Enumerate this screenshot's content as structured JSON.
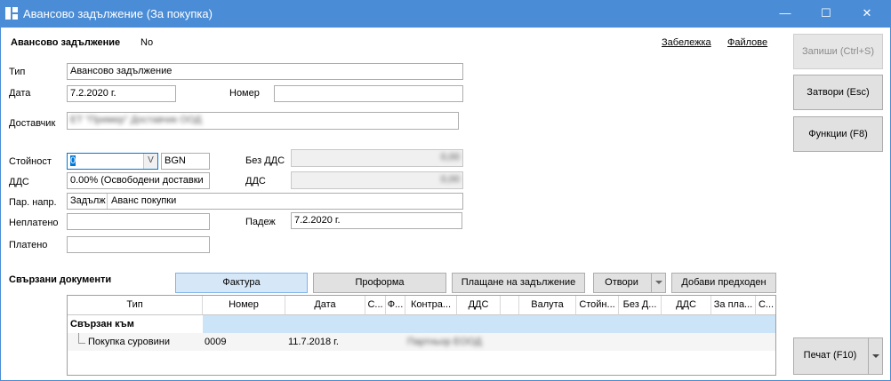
{
  "window": {
    "title": "Авансово задължение (За покупка)",
    "minimize_glyph": "—",
    "maximize_glyph": "☐",
    "close_glyph": "✕"
  },
  "header": {
    "doc_type_label": "Авансово задължение",
    "no_label": "No",
    "note_link": "Забележка",
    "files_link": "Файлове"
  },
  "form": {
    "type_label": "Тип",
    "type_value": "Авансово задължение",
    "date_label": "Дата",
    "date_value": "7.2.2020 г.",
    "number_label": "Номер",
    "number_value": "",
    "supplier_label": "Доставчик",
    "supplier_value": "ЕТ \"Пример\" Доставчик ООД",
    "amount_label": "Стойност",
    "amount_value": "0",
    "amount_dropdown_glyph": "V",
    "currency_value": "BGN",
    "without_vat_label": "Без ДДС",
    "without_vat_value": "0,00",
    "vat_label": "ДДС",
    "vat_rate_value": "0.00% (Освободени доставки",
    "vat_amount_label": "ДДС",
    "vat_amount_value": "0,00",
    "account_label": "Пар. напр.",
    "account_code_value": "Задълж",
    "account_name_value": "Аванс покупки",
    "unpaid_label": "Неплатено",
    "unpaid_value": "",
    "due_label": "Падеж",
    "due_value": "7.2.2020 г.",
    "paid_label": "Платено",
    "paid_value": ""
  },
  "sidebar": {
    "save_button": "Запиши (Ctrl+S)",
    "close_button": "Затвори (Esc)",
    "functions_button": "Функции (F8)",
    "print_button": "Печат (F10)"
  },
  "linked": {
    "section_label": "Свързани документи",
    "buttons": {
      "invoice": "Фактура",
      "proforma": "Проформа",
      "payment": "Плащане на задължение",
      "open": "Отвори",
      "add_previous": "Добави предходен"
    },
    "columns": [
      "Тип",
      "Номер",
      "Дата",
      "С...",
      "Ф...",
      "Контра...",
      "ДДС",
      "",
      "Валута",
      "Стойн...",
      "Без Д...",
      "ДДС",
      "За пла...",
      "С..."
    ],
    "group_label": "Свързан към",
    "rows": [
      {
        "type": "Покупка суровини",
        "number": "0009",
        "date": "11.7.2018 г.",
        "counterparty": "Партньор ЕООД"
      }
    ]
  }
}
